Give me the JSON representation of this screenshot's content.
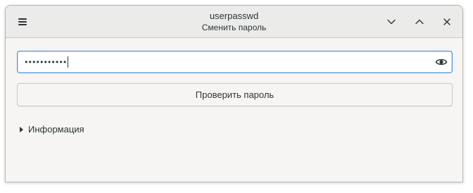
{
  "window": {
    "title": "userpasswd",
    "subtitle": "Сменить пароль"
  },
  "headerbar": {
    "menu_icon": "hamburger-menu-icon",
    "minimize_icon": "chevron-down-icon",
    "maximize_icon": "chevron-up-icon",
    "close_icon": "close-icon"
  },
  "password": {
    "masked_value": "•••••••••••",
    "reveal_icon": "eye-icon"
  },
  "actions": {
    "check_label": "Проверить пароль"
  },
  "info": {
    "expander_label": "Информация"
  },
  "colors": {
    "focus_accent": "#4a90d9",
    "window_bg": "#f6f5f4",
    "text": "#2e3436"
  }
}
